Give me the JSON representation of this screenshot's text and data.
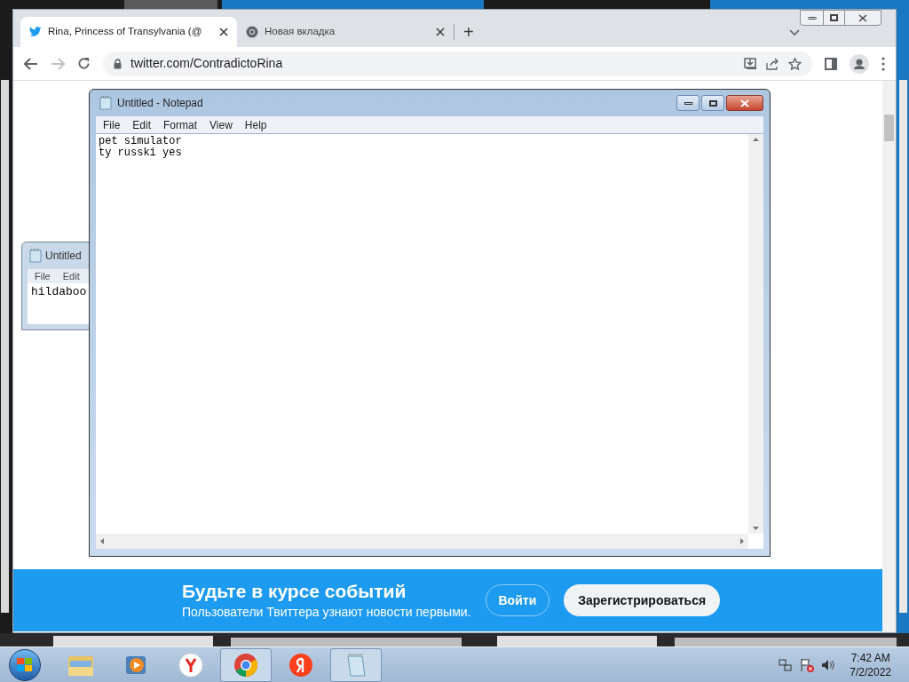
{
  "browser": {
    "tabs": [
      {
        "title": "Rina, Princess of Transylvania (@",
        "kind": "twitter",
        "selected": true
      },
      {
        "title": "Новая вкладка",
        "kind": "chrome",
        "selected": false
      }
    ],
    "new_tab": "+",
    "address": "twitter.com/ContradictoRina",
    "banner": {
      "title": "Будьте в курсе событий",
      "subtitle": "Пользователи Твиттера узнают новости первыми.",
      "login": "Войти",
      "signup": "Зарегистрироваться"
    }
  },
  "notepad_back": {
    "title": "Untitled",
    "menu": [
      "File",
      "Edit"
    ],
    "text": "hildaboo"
  },
  "notepad": {
    "title": "Untitled - Notepad",
    "menu": [
      "File",
      "Edit",
      "Format",
      "View",
      "Help"
    ],
    "lines": [
      "pet simulator",
      "ty russki yes"
    ]
  },
  "taskbar": {
    "items": [
      {
        "kind": "folder",
        "active": false
      },
      {
        "kind": "media",
        "active": false
      },
      {
        "kind": "yandex-browser",
        "active": false
      },
      {
        "kind": "chrome",
        "active": true
      },
      {
        "kind": "yandex",
        "active": false
      },
      {
        "kind": "notepad",
        "active": true
      }
    ],
    "time": "7:42 AM",
    "date": "7/2/2022"
  }
}
